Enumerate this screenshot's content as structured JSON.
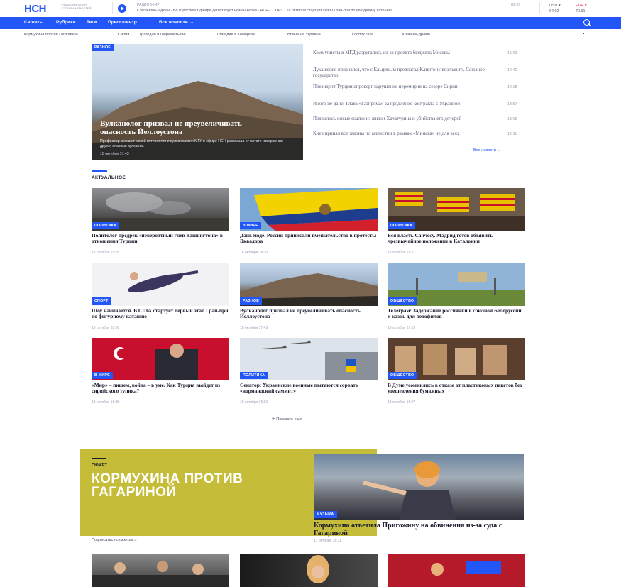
{
  "header": {
    "logo": "НСН",
    "logo_sub": "НАЦИОНАЛЬНАЯ СЛУЖБА НОВОСТЕЙ",
    "radio_title": "РАДИОЭФИР",
    "ticker": "Степанова-Бурзен  ·  Во взрослом турнире дебютирует Роман Агаев  ·  НСН-СПОРТ  ·  18 октября стартует сезон Гран-при по фигурному катанию",
    "time": "09:01",
    "usd_label": "USD ▾",
    "usd_value": "64.02",
    "eur_label": "EUR ▾",
    "eur_value": "70.91"
  },
  "nav": {
    "items": [
      "Сюжеты",
      "Рубрики",
      "Теги",
      "Пресс-центр",
      "Все новости →"
    ]
  },
  "tags": {
    "items": [
      "Кормухина против Гагариной",
      "Сирия",
      "Трагедия в Шереметьеве",
      "Трагедия в Кемерове",
      "Война на Украине",
      "Хлопок газа",
      "Храм-на-драме"
    ],
    "more": "···"
  },
  "hero": {
    "badge": "РАЗНОЕ",
    "title": "Вулканолог призвал не преувеличивать опасность Йеллоустона",
    "desc": "Профессор вулканической петрологии и вулканологии МГУ в эфире НСН рассказал о частоте извержения других опасных вулканов.",
    "date": "18 октября 17:43"
  },
  "news": {
    "items": [
      {
        "text": "Коммунисты в МГД разругались из-за проекта бюджета Москвы",
        "time": "15:03"
      },
      {
        "text": "Лукашенко признался, что с Ельциным предлагал Клинтону возглавить Союзное государство",
        "time": "14:40"
      },
      {
        "text": "Президент Турции опроверг нарушение перемирия на севере Сирии",
        "time": "14:28"
      },
      {
        "text": "Иного не дано. Глава «Газпрома» за продление контракта с Украиной",
        "time": "13:57"
      },
      {
        "text": "Появились новые факты из жизни Хачатурина и убийства его дочерей",
        "time": "13:05"
      },
      {
        "text": "Киев принял все законы по амнистии в рамках «Минска» не для всех",
        "time": "12:11"
      }
    ],
    "all_link": "Все новости →"
  },
  "section": {
    "title": "АКТУАЛЬНОЕ"
  },
  "cards": [
    {
      "badge": "ПОЛИТИКА",
      "title": "Политолог предрек «невероятный гнев Вашингтона» в отношении Турции",
      "date": "18 октября 18:28"
    },
    {
      "badge": "В МИРЕ",
      "title": "Дань моде. России приписали вмешательство в протесты Эквадора",
      "date": "18 октября 18:10"
    },
    {
      "badge": "ПОЛИТИКА",
      "title": "Вся власть Санчесу. Мадрид готов объявить чрезвычайное положение в Каталонии",
      "date": "18 октября 18:11"
    },
    {
      "badge": "СПОРТ",
      "title": "Шоу начинается. В США стартует первый этап Гран-при по фигурному катанию",
      "date": "18 октября 18:00"
    },
    {
      "badge": "РАЗНОЕ",
      "title": "Вулканолог призвал не преувеличивать опасность Йеллоустона",
      "date": "18 октября 17:43"
    },
    {
      "badge": "ОБЩЕСТВО",
      "title": "Телеграм: Задержание россиянки в союзной Белоруссии и казнь для педофилов",
      "date": "18 октября 17:19"
    },
    {
      "badge": "В МИРЕ",
      "title": "«Мир» – пишем, война – в уме. Как Турция выйдет из сирийского тупика?",
      "date": "18 октября 16:35"
    },
    {
      "badge": "ПОЛИТИКА",
      "title": "Сенатор: Украинские военные пытаются сорвать «нормандский саммит»",
      "date": "18 октября 16:30"
    },
    {
      "badge": "ОБЩЕСТВО",
      "title": "В Думе усомнились в отказе от пластиковых пакетов без удешевления бумажных",
      "date": "18 октября 16:07"
    }
  ],
  "load_more": "⟳ Показать еще",
  "story": {
    "label": "СЮЖЕТ",
    "title": "КОРМУХИНА ПРОТИВ ГАГАРИНОЙ",
    "badge": "МУЗЫКА",
    "headline": "Кормухина ответила Пригожину на обвинения из-за суда с Гагариной",
    "date": "17 октября 18:11",
    "subscribe": "Подписаться сюжетом ♫"
  },
  "colors": {
    "accent": "#2356f6",
    "story_yellow": "#c5bd3a",
    "red": "#e0314b"
  }
}
